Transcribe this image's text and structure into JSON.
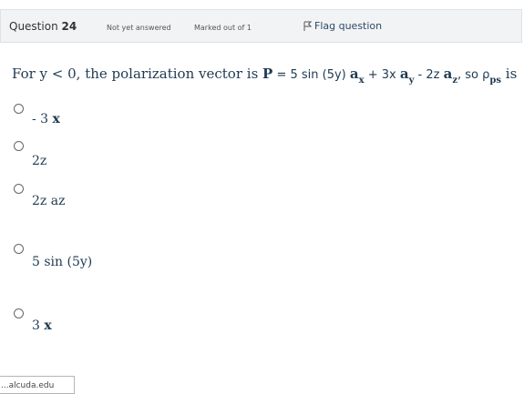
{
  "header": {
    "question_word": "Question",
    "question_number": "24",
    "state": "Not yet answered",
    "grade": "Marked out of 1",
    "flag_label": "Flag question"
  },
  "question": {
    "prefix": "For y < 0, the polarization vector is ",
    "P_symbol": "P",
    "eq_part1": " = 5 sin (5y) ",
    "a_symbol_1": "a",
    "sub_1": "x",
    "eq_part2": " + 3x ",
    "a_symbol_2": "a",
    "sub_2": "y",
    "eq_part3": " - 2z ",
    "a_symbol_3": "a",
    "sub_3": "z",
    "eq_part4": ", so ρ",
    "sub_4": "ps",
    "suffix": " is"
  },
  "options": [
    {
      "prefix": "- 3 ",
      "bold": "x"
    },
    {
      "prefix": "2z",
      "bold": ""
    },
    {
      "prefix": "2z az",
      "bold": ""
    },
    {
      "prefix": "5 sin (5y)",
      "bold": ""
    },
    {
      "prefix": "3 ",
      "bold": "x"
    }
  ],
  "footer": {
    "text": "...alcuda.edu"
  }
}
